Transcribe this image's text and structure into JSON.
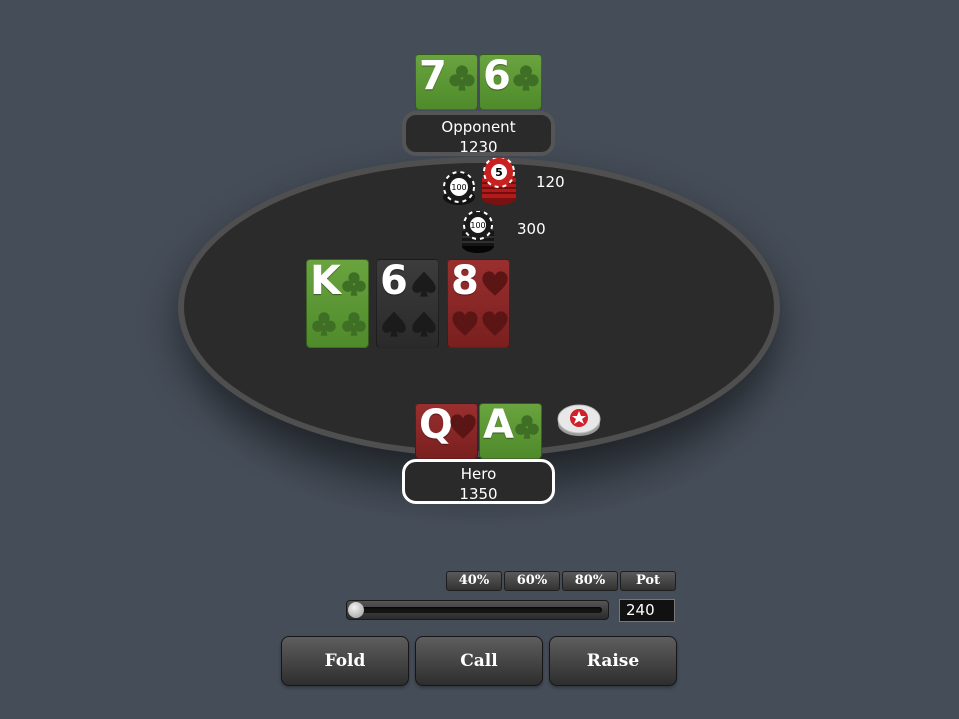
{
  "opponent": {
    "name": "Opponent",
    "stack": "1230",
    "cards": [
      {
        "rank": "7",
        "suit": "clubs"
      },
      {
        "rank": "6",
        "suit": "clubs"
      }
    ],
    "bet": "120"
  },
  "hero": {
    "name": "Hero",
    "stack": "1350",
    "cards": [
      {
        "rank": "Q",
        "suit": "hearts"
      },
      {
        "rank": "A",
        "suit": "clubs"
      }
    ],
    "bet": "300",
    "dealer_button_icon": "pokerstars-dealer-button-icon"
  },
  "board": {
    "cards": [
      {
        "rank": "K",
        "suit": "clubs"
      },
      {
        "rank": "6",
        "suit": "spades"
      },
      {
        "rank": "8",
        "suit": "hearts"
      }
    ]
  },
  "chips": {
    "opponent_stack_chip_labels": [
      "100",
      "5"
    ],
    "hero_stack_chip_labels": [
      "100"
    ]
  },
  "controls": {
    "presets": [
      "40%",
      "60%",
      "80%",
      "Pot"
    ],
    "bet_amount": "240",
    "slider_level": 0,
    "fold_label": "Fold",
    "call_label": "Call",
    "raise_label": "Raise"
  },
  "colors": {
    "background": "#454d58",
    "felt": "#2b2b2b",
    "clubs": "#5a9a35",
    "spades": "#333333",
    "hearts": "#8a2727"
  }
}
